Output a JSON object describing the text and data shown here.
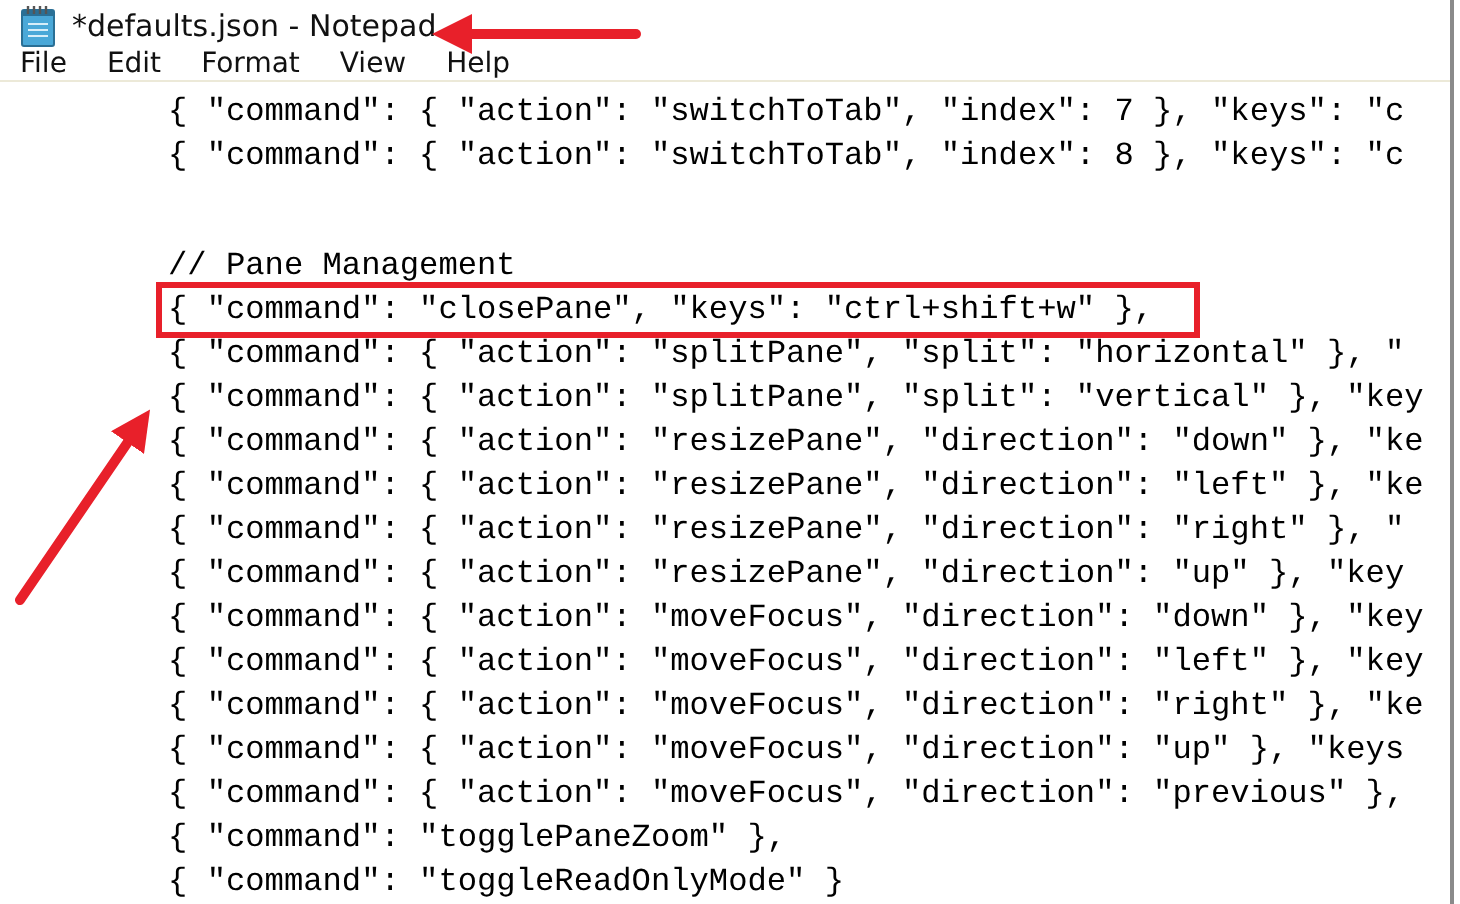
{
  "window": {
    "title": "*defaults.json - Notepad"
  },
  "menu": [
    "File",
    "Edit",
    "Format",
    "View",
    "Help"
  ],
  "editor": {
    "sections": [
      {
        "lines": [
          {
            "text": "{ \"command\": { \"action\": \"switchToTab\", \"index\": 7 }, \"keys\": \"c",
            "highlighted": false
          },
          {
            "text": "{ \"command\": { \"action\": \"switchToTab\", \"index\": 8 }, \"keys\": \"c",
            "highlighted": false
          }
        ]
      },
      {
        "lines": [
          {
            "text": "// Pane Management",
            "highlighted": false
          },
          {
            "text": "{ \"command\": \"closePane\", \"keys\": \"ctrl+shift+w\" },",
            "highlighted": true
          },
          {
            "text": "{ \"command\": { \"action\": \"splitPane\", \"split\": \"horizontal\" }, \"",
            "highlighted": false
          },
          {
            "text": "{ \"command\": { \"action\": \"splitPane\", \"split\": \"vertical\" }, \"key",
            "highlighted": false
          },
          {
            "text": "{ \"command\": { \"action\": \"resizePane\", \"direction\": \"down\" }, \"ke",
            "highlighted": false
          },
          {
            "text": "{ \"command\": { \"action\": \"resizePane\", \"direction\": \"left\" }, \"ke",
            "highlighted": false
          },
          {
            "text": "{ \"command\": { \"action\": \"resizePane\", \"direction\": \"right\" }, \"",
            "highlighted": false
          },
          {
            "text": "{ \"command\": { \"action\": \"resizePane\", \"direction\": \"up\" }, \"key",
            "highlighted": false
          },
          {
            "text": "{ \"command\": { \"action\": \"moveFocus\", \"direction\": \"down\" }, \"key",
            "highlighted": false
          },
          {
            "text": "{ \"command\": { \"action\": \"moveFocus\", \"direction\": \"left\" }, \"key",
            "highlighted": false
          },
          {
            "text": "{ \"command\": { \"action\": \"moveFocus\", \"direction\": \"right\" }, \"ke",
            "highlighted": false
          },
          {
            "text": "{ \"command\": { \"action\": \"moveFocus\", \"direction\": \"up\" }, \"keys",
            "highlighted": false
          },
          {
            "text": "{ \"command\": { \"action\": \"moveFocus\", \"direction\": \"previous\" },",
            "highlighted": false
          },
          {
            "text": "{ \"command\": \"togglePaneZoom\" },",
            "highlighted": false
          },
          {
            "text": "{ \"command\": \"toggleReadOnlyMode\" }",
            "highlighted": false
          }
        ]
      }
    ]
  }
}
